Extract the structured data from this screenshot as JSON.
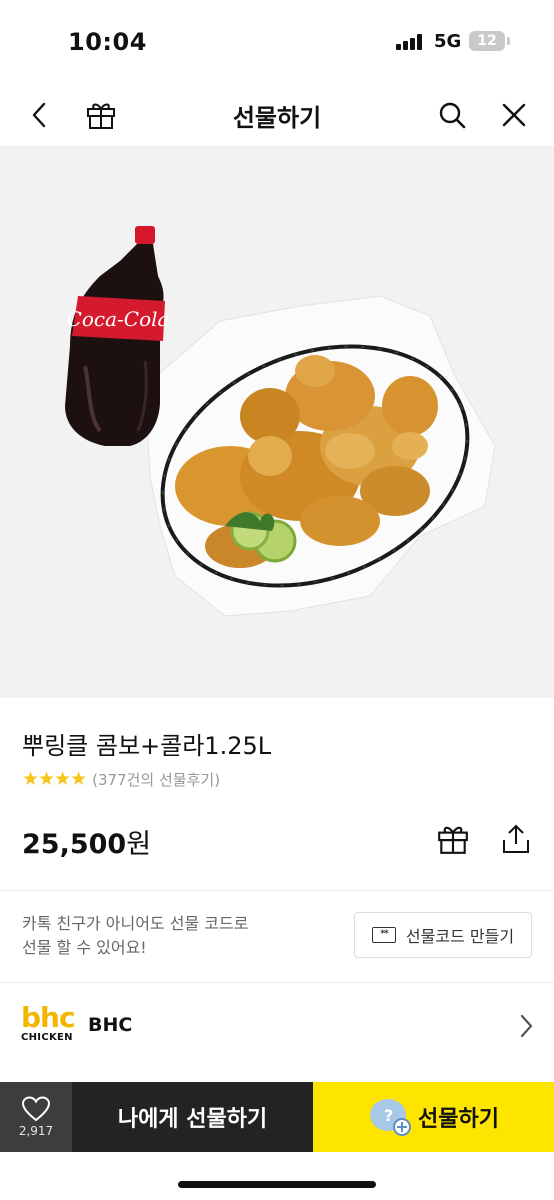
{
  "status_bar": {
    "time": "10:04",
    "network": "5G",
    "battery": "12"
  },
  "nav": {
    "title": "선물하기",
    "icons": [
      "back-chevron-icon",
      "gift-box-icon",
      "search-icon",
      "close-icon"
    ]
  },
  "product": {
    "name": "뿌링클 콤보+콜라1.25L",
    "rating_stars": 4,
    "stars_text": "★★★★",
    "review_count": "(377건의 선물후기)",
    "price_number": "25,500",
    "price_unit": "원",
    "image_bottle_label": "Coca-Cola"
  },
  "gift_code": {
    "text_line1": "카톡 친구가 아니어도 선물 코드로",
    "text_line2": "선물 할 수 있어요!",
    "button_label": "선물코드 만들기",
    "button_icon_text": "**"
  },
  "brand": {
    "logo_top": "bhc",
    "logo_bottom": "CHICKEN",
    "name": "BHC"
  },
  "bottom_bar": {
    "like_count": "2,917",
    "self_gift_label": "나에게 선물하기",
    "gift_label": "선물하기"
  },
  "colors": {
    "kakao_yellow": "#fee500",
    "dark": "#232323",
    "star": "#f5c518",
    "bhc_gold": "#f2b600"
  }
}
